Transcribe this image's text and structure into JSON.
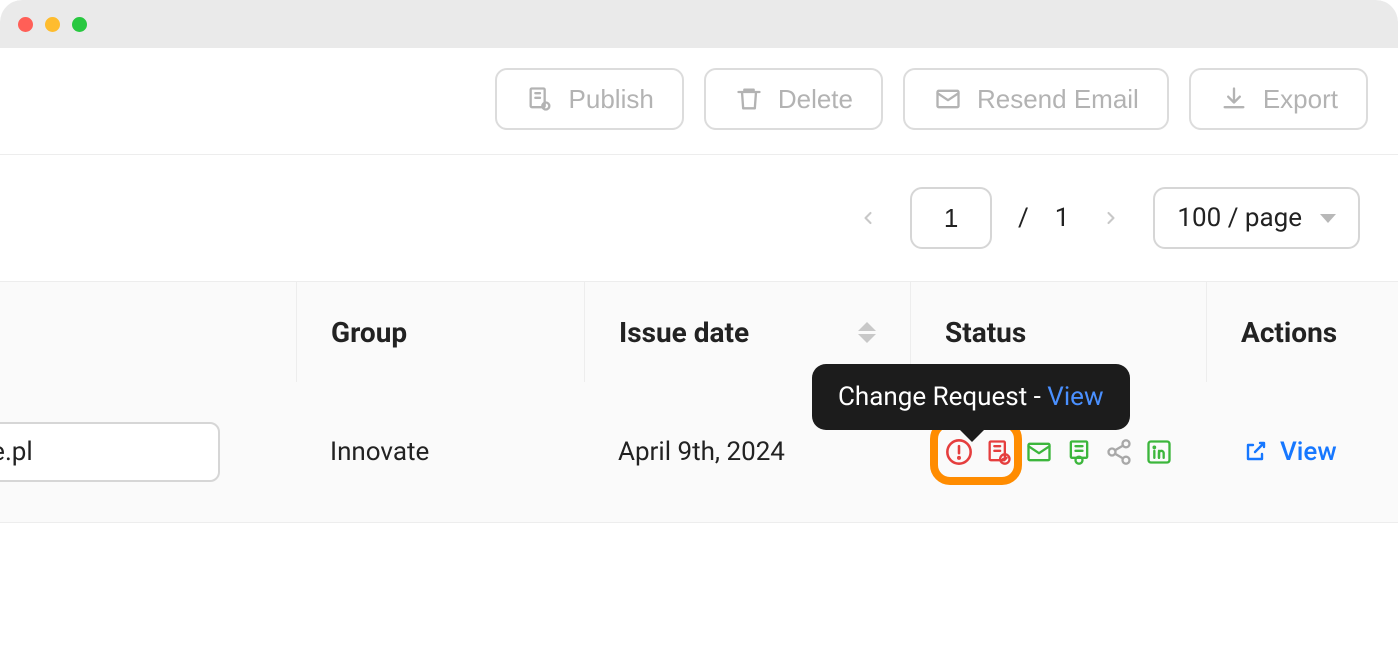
{
  "toolbar": {
    "publish_label": "Publish",
    "delete_label": "Delete",
    "resend_label": "Resend Email",
    "export_label": "Export"
  },
  "pagination": {
    "current": "1",
    "separator": "/",
    "total": "1",
    "page_size_label": "100 / page"
  },
  "columns": {
    "group": "Group",
    "issue_date": "Issue date",
    "status": "Status",
    "actions": "Actions"
  },
  "row": {
    "truncated_name": "ole.pl",
    "group": "Innovate",
    "issue_date": "April 9th, 2024",
    "view_label": "View"
  },
  "tooltip": {
    "text": "Change Request - ",
    "link": "View"
  },
  "icons": {
    "publish": "publish-icon",
    "delete": "trash-icon",
    "mail": "mail-icon",
    "download": "download-icon",
    "alert": "alert-circle-icon",
    "doc_check": "document-check-icon",
    "envelope": "envelope-icon",
    "cert": "certificate-icon",
    "share": "share-icon",
    "linkedin": "linkedin-icon",
    "external": "external-link-icon"
  },
  "colors": {
    "orange": "#ff8c00",
    "red": "#e53e3e",
    "green": "#3cb63c",
    "gray": "#a8a8a8",
    "blue": "#1677ff"
  }
}
